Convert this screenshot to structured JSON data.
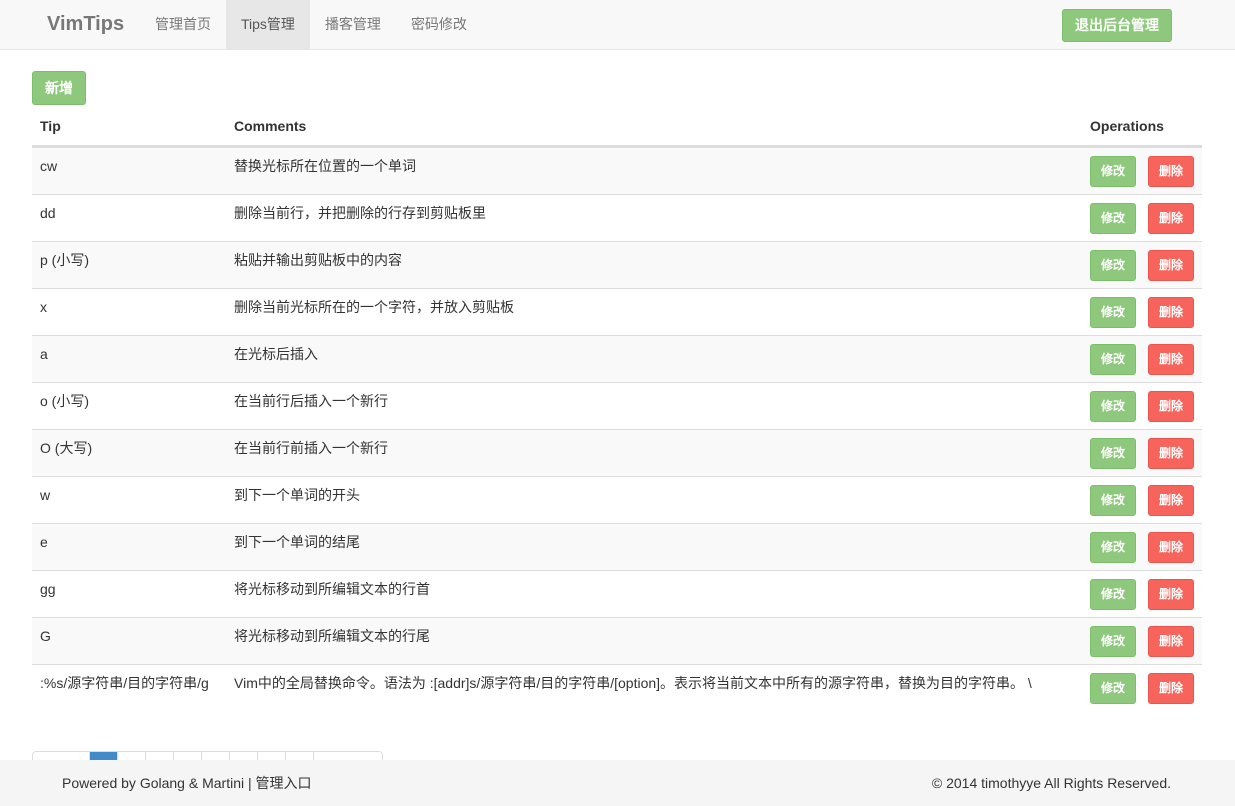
{
  "navbar": {
    "brand": "VimTips",
    "items": [
      {
        "label": "管理首页",
        "active": false
      },
      {
        "label": "Tips管理",
        "active": true
      },
      {
        "label": "播客管理",
        "active": false
      },
      {
        "label": "密码修改",
        "active": false
      }
    ],
    "logout_label": "退出后台管理"
  },
  "toolbar": {
    "add_label": "新增"
  },
  "table": {
    "headers": {
      "tip": "Tip",
      "comments": "Comments",
      "operations": "Operations"
    },
    "edit_label": "修改",
    "delete_label": "删除",
    "rows": [
      {
        "tip": "cw",
        "comment": "替换光标所在位置的一个单词"
      },
      {
        "tip": "dd",
        "comment": "删除当前行，并把删除的行存到剪贴板里"
      },
      {
        "tip": "p (小写)",
        "comment": "粘贴并输出剪贴板中的内容"
      },
      {
        "tip": "x",
        "comment": "删除当前光标所在的一个字符，并放入剪贴板"
      },
      {
        "tip": "a",
        "comment": "在光标后插入"
      },
      {
        "tip": "o (小写)",
        "comment": "在当前行后插入一个新行"
      },
      {
        "tip": "O (大写)",
        "comment": "在当前行前插入一个新行"
      },
      {
        "tip": "w",
        "comment": "到下一个单词的开头"
      },
      {
        "tip": "e",
        "comment": "到下一个单词的结尾"
      },
      {
        "tip": "gg",
        "comment": "将光标移动到所编辑文本的行首"
      },
      {
        "tip": "G",
        "comment": "将光标移动到所编辑文本的行尾"
      },
      {
        "tip": ":%s/源字符串/目的字符串/g",
        "comment": "Vim中的全局替换命令。语法为 :[addr]s/源字符串/目的字符串/[option]。表示将当前文本中所有的源字符串，替换为目的字符串。 \\"
      }
    ]
  },
  "footer": {
    "left": "Powered by Golang & Martini | 管理入口",
    "right": "© 2014 timothyye All Rights Reserved."
  },
  "colors": {
    "success": "#8dc87c",
    "danger": "#f6645c",
    "primary": "#428bca"
  }
}
